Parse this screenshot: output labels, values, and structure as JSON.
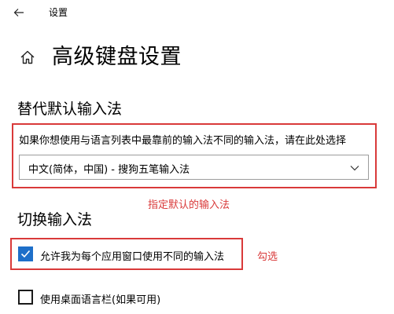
{
  "window": {
    "title": "设置"
  },
  "header": {
    "back_icon": "back-arrow-icon",
    "home_icon": "home-icon",
    "page_title": "高级键盘设置"
  },
  "override_section": {
    "title": "替代默认输入法",
    "description": "如果你想使用与语言列表中最靠前的输入法不同的输入法，请在此处选择",
    "dropdown": {
      "selected": "中文(简体，中国) - 搜狗五笔输入法",
      "chevron_icon": "chevron-down-icon"
    },
    "annotation": "指定默认的输入法"
  },
  "switch_section": {
    "title": "切换输入法",
    "options": [
      {
        "label": "允许我为每个应用窗口使用不同的输入法",
        "checked": true
      },
      {
        "label": "使用桌面语言栏(如果可用)",
        "checked": false
      }
    ],
    "annotation": "勾选"
  },
  "colors": {
    "highlight_red": "#d93a3a",
    "accent_blue": "#1e6fc9"
  }
}
